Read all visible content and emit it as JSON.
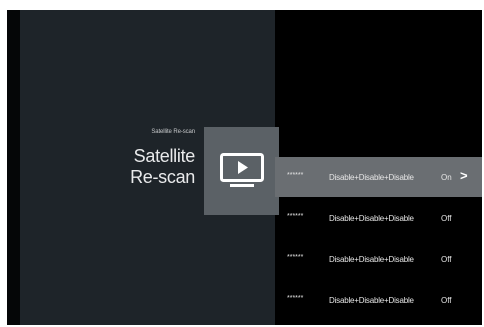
{
  "header": {
    "breadcrumb": "Satellite Re-scan",
    "title_line1": "Satellite",
    "title_line2": "Re-scan"
  },
  "icon": {
    "name": "tv-play-icon"
  },
  "rows": [
    {
      "id": "******",
      "value": "Disable+Disable+Disable",
      "state": "On",
      "selected": true,
      "chevron": ">"
    },
    {
      "id": "******",
      "value": "Disable+Disable+Disable",
      "state": "Off",
      "selected": false
    },
    {
      "id": "******",
      "value": "Disable+Disable+Disable",
      "state": "Off",
      "selected": false
    },
    {
      "id": "******",
      "value": "Disable+Disable+Disable",
      "state": "Off",
      "selected": false
    }
  ],
  "colors": {
    "background": "#000000",
    "panel": "#1e2429",
    "tile": "#5b6166",
    "selected_row": "#6a6e72",
    "text": "#e6e6e6"
  }
}
